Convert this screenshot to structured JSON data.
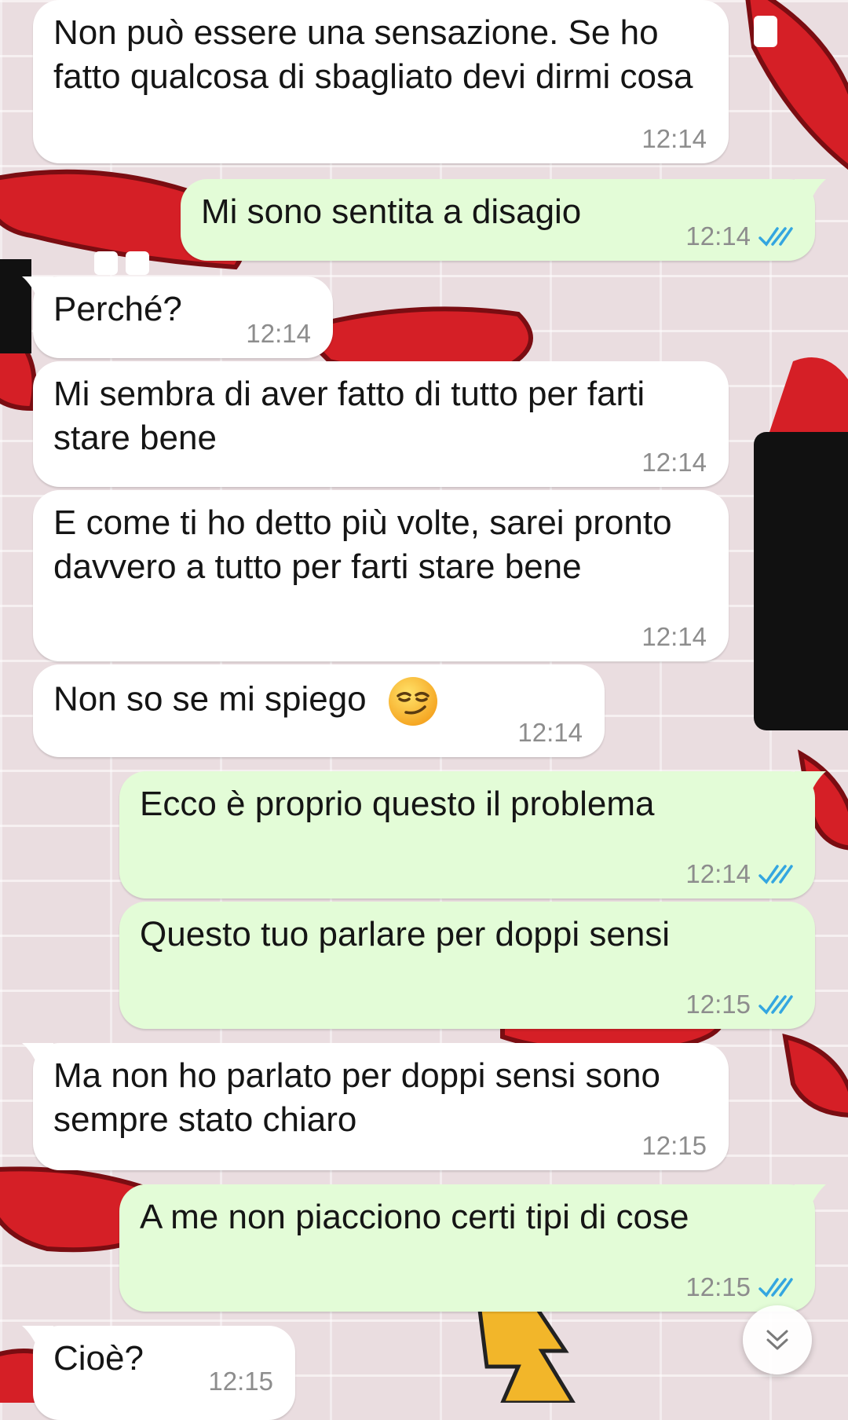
{
  "colors": {
    "incoming_bubble": "#ffffff",
    "outgoing_bubble": "#e3fcd7",
    "read_ticks": "#34a6e0",
    "timestamp": "#8d8d8d",
    "wallpaper_lips": "#d51f26",
    "wallpaper_lipstick": "#111111"
  },
  "icons": {
    "read_receipt": "double-check-icon",
    "scroll_down": "double-chevron-down-icon",
    "emoji": "smirking-face-emoji"
  },
  "messages": [
    {
      "direction": "incoming",
      "text": "Non può essere una sensazione. Se ho fatto qualcosa di sbagliato devi dirmi cosa",
      "time": "12:14"
    },
    {
      "direction": "outgoing",
      "text": "Mi sono sentita a disagio",
      "time": "12:14",
      "read": true
    },
    {
      "direction": "incoming",
      "text": "Perché?",
      "time": "12:14"
    },
    {
      "direction": "incoming",
      "text": "Mi sembra di aver fatto di tutto per farti stare bene",
      "time": "12:14"
    },
    {
      "direction": "incoming",
      "text": "E come ti ho detto più volte, sarei pronto davvero a tutto per farti stare bene",
      "time": "12:14"
    },
    {
      "direction": "incoming",
      "text": "Non so se mi spiego",
      "emoji": "😏",
      "time": "12:14"
    },
    {
      "direction": "outgoing",
      "text": "Ecco è proprio questo il problema",
      "time": "12:14",
      "read": true
    },
    {
      "direction": "outgoing",
      "text": "Questo tuo parlare per doppi sensi",
      "time": "12:15",
      "read": true
    },
    {
      "direction": "incoming",
      "text": "Ma non ho parlato per doppi sensi sono sempre stato chiaro",
      "time": "12:15"
    },
    {
      "direction": "outgoing",
      "text": "A me non piacciono certi tipi di cose",
      "time": "12:15",
      "read": true
    },
    {
      "direction": "incoming",
      "text": "Cioè?",
      "time": "12:15"
    }
  ]
}
